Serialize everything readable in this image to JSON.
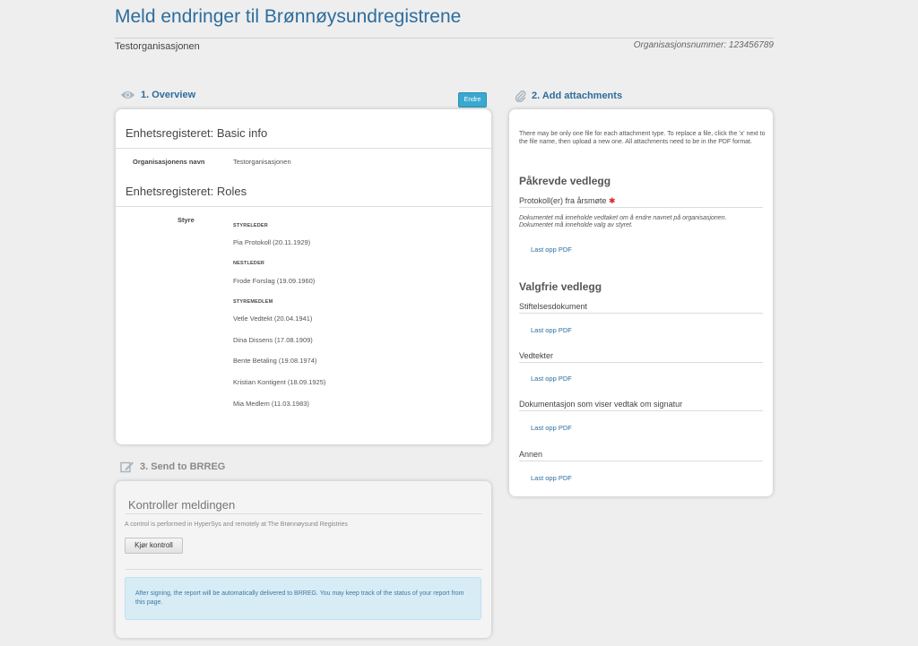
{
  "page": {
    "title": "Meld endringer til Brønnøysundregistrene",
    "org_name": "Testorganisasjonen",
    "org_number": "Organisasjonsnummer: 123456789"
  },
  "overview": {
    "heading": "1. Overview",
    "edit_label": "Endre",
    "basic_info_heading": "Enhetsregisteret: Basic info",
    "org_name_label": "Organisasjonens navn",
    "org_name_value": "Testorganisasjonen",
    "roles_heading": "Enhetsregisteret: Roles",
    "board_label": "Styre",
    "roles": [
      {
        "category": "STYRELEDER",
        "people": [
          "Pia Protokoll (20.11.1929)"
        ]
      },
      {
        "category": "NESTLEDER",
        "people": [
          "Frode Forslag (19.09.1960)"
        ]
      },
      {
        "category": "STYREMEDLEM",
        "people": [
          "Vetle Vedtekt (20.04.1941)",
          "Dina Dissens (17.08.1909)",
          "Bente Betaling (19.08.1974)",
          "Kristian Kontigent (18.09.1925)",
          "Mia Medlem (11.03.1983)"
        ]
      }
    ]
  },
  "attachments": {
    "heading": "2. Add attachments",
    "intro": "There may be only one file for each attachment type. To replace a file, click the 'x' next to the file name, then upload a new one. All attachments need to be in the PDF format.",
    "required_heading": "Påkrevde vedlegg",
    "required_type": "Protokoll(er) fra årsmøte",
    "required_star": "✱",
    "required_note": "Dokumentet må inneholde vedtaket om å endre navnet på organisasjonen. Dokumentet må inneholde valg av styret.",
    "optional_heading": "Valgfrie vedlegg",
    "upload_label": "Last opp PDF",
    "optional_types": [
      "Stiftelsesdokument",
      "Vedtekter",
      "Dokumentasjon som viser vedtak om signatur",
      "Annen"
    ]
  },
  "send": {
    "heading": "3. Send to BRREG",
    "check_heading": "Kontroller meldingen",
    "check_desc": "A control is performed in HyperSys and remotely at The Brønnøysund Registries",
    "check_button": "Kjør kontroll",
    "info": "After signing, the report will be automatically delivered to BRREG. You may keep track of the status of your report from this page."
  },
  "colors": {
    "link_blue": "#2d6d9e",
    "button_blue": "#3aa8cf",
    "required_red": "#d9262c",
    "info_bg": "#d8ecf6"
  },
  "icons": [
    "eye-icon",
    "paperclip-icon",
    "edit-icon"
  ]
}
